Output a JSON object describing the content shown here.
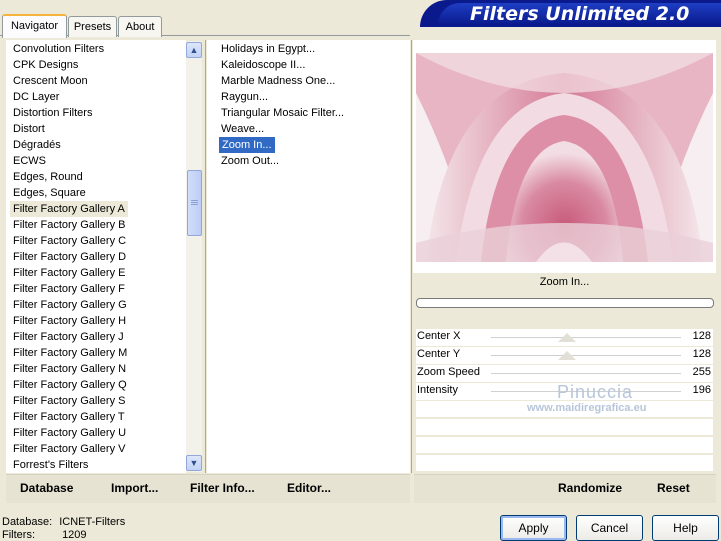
{
  "title": "Filters Unlimited 2.0",
  "tabs": [
    "Navigator",
    "Presets",
    "About"
  ],
  "categories": [
    "Convolution Filters",
    "CPK Designs",
    "Crescent Moon",
    "DC Layer",
    "Distortion Filters",
    "Distort",
    "Dégradés",
    "ECWS",
    "Edges, Round",
    "Edges, Square",
    "Filter Factory Gallery A",
    "Filter Factory Gallery B",
    "Filter Factory Gallery C",
    "Filter Factory Gallery D",
    "Filter Factory Gallery E",
    "Filter Factory Gallery F",
    "Filter Factory Gallery G",
    "Filter Factory Gallery H",
    "Filter Factory Gallery J",
    "Filter Factory Gallery M",
    "Filter Factory Gallery N",
    "Filter Factory Gallery Q",
    "Filter Factory Gallery S",
    "Filter Factory Gallery T",
    "Filter Factory Gallery U",
    "Filter Factory Gallery V",
    "Forrest's Filters"
  ],
  "selected_category": "Filter Factory Gallery A",
  "filters": [
    "Holidays in Egypt...",
    "Kaleidoscope II...",
    "Marble Madness One...",
    "Raygun...",
    "Triangular Mosaic Filter...",
    "Weave...",
    "Zoom In...",
    "Zoom Out..."
  ],
  "selected_filter": "Zoom In...",
  "preview_label": "Zoom In...",
  "params": [
    {
      "label": "Center X",
      "value": "128"
    },
    {
      "label": "Center Y",
      "value": "128"
    },
    {
      "label": "Zoom Speed",
      "value": "255"
    },
    {
      "label": "Intensity",
      "value": "196"
    }
  ],
  "watermark": {
    "name": "Pinuccia",
    "site": "www.maidiregrafica.eu"
  },
  "bottom_bar": {
    "database": "Database",
    "import": "Import...",
    "filter_info": "Filter Info...",
    "editor": "Editor...",
    "randomize": "Randomize",
    "reset": "Reset"
  },
  "status": {
    "database_label": "Database:",
    "database_value": "ICNET-Filters",
    "filters_label": "Filters:",
    "filters_value": "1209"
  },
  "buttons": {
    "apply": "Apply",
    "cancel": "Cancel",
    "help": "Help"
  },
  "colors": {
    "selection": "#316ac5",
    "banner": "#0a1a8c",
    "preview_pink": "#c97890"
  }
}
